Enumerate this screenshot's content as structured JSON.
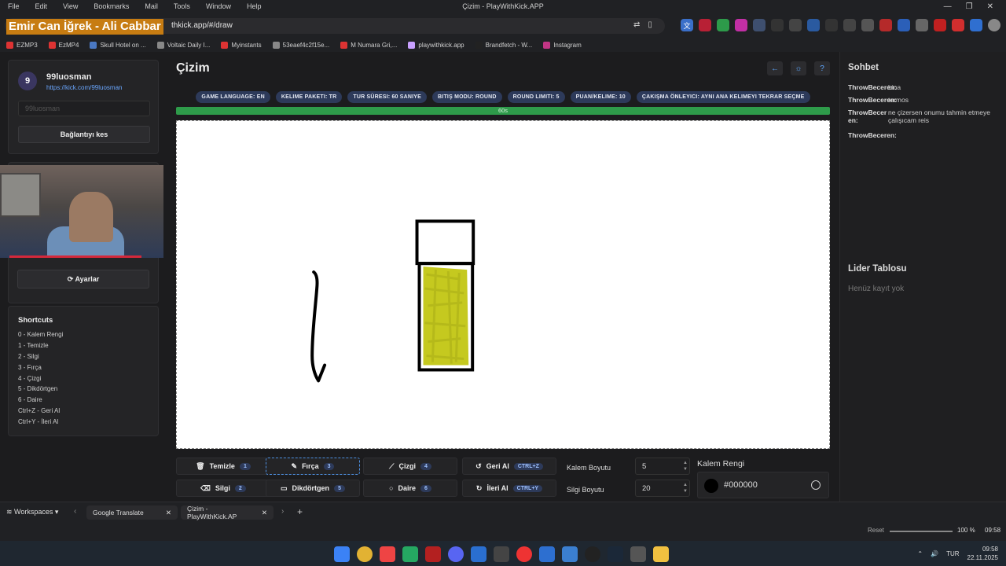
{
  "menubar": {
    "items": [
      "File",
      "Edit",
      "View",
      "Bookmarks",
      "Mail",
      "Tools",
      "Window",
      "Help"
    ],
    "window_title": "Çizim - PlayWithKick.APP"
  },
  "address": {
    "url": "thkick.app/#/draw"
  },
  "overlay": {
    "streamer_names": "Emir Can İğrek - Ali Cabbar"
  },
  "bookmarks": [
    {
      "label": "EZMP3",
      "color": "#d33"
    },
    {
      "label": "EzMP4",
      "color": "#d33"
    },
    {
      "label": "Skull Hotel on ...",
      "color": "#4a78c2"
    },
    {
      "label": "Voltaic Daily I...",
      "color": "#888"
    },
    {
      "label": "Myinstants",
      "color": "#d33"
    },
    {
      "label": "53eaef4c2f15e...",
      "color": "#888"
    },
    {
      "label": "M Numara Gri,...",
      "color": "#d33"
    },
    {
      "label": "playwithkick.app",
      "color": "#c8a0ff"
    },
    {
      "label": "Brandfetch - W...",
      "color": "#222"
    },
    {
      "label": "Instagram",
      "color": "#c13584"
    }
  ],
  "profile": {
    "avatar_initial": "9",
    "username": "99luosman",
    "link": "https://kick.com/99luosman",
    "input_placeholder": "99luosman",
    "disconnect_label": "Bağlantıyı kes"
  },
  "settings_label": "Ayarlar",
  "shortcuts": {
    "title": "Shortcuts",
    "items": [
      "0 - Kalem Rengi",
      "1 - Temizle",
      "2 - Silgi",
      "3 - Fırça",
      "4 - Çizgi",
      "5 - Dikdörtgen",
      "6 - Daire",
      "Ctrl+Z - Geri Al",
      "Ctrl+Y - İleri Al"
    ]
  },
  "page": {
    "title": "Çizim"
  },
  "badges": [
    "GAME LANGUAGE: EN",
    "KELIME PAKETI: TR",
    "TUR SÜRESI: 60 SANIYE",
    "BITIŞ MODU: ROUND",
    "ROUND LIMITI: 5",
    "PUAN/KELIME: 10",
    "ÇAKIŞMA ÖNLEYICI: AYNI ANA KELIMEYI TEKRAR SEÇME"
  ],
  "timer": {
    "label": "60s",
    "fraction": 1.0
  },
  "tools": {
    "clear": {
      "label": "Temizle",
      "key": "1"
    },
    "brush": {
      "label": "Fırça",
      "key": "3"
    },
    "line": {
      "label": "Çizgi",
      "key": "4"
    },
    "undo": {
      "label": "Geri Al",
      "key": "CTRL+Z"
    },
    "eraser": {
      "label": "Silgi",
      "key": "2"
    },
    "rect": {
      "label": "Dikdörtgen",
      "key": "5"
    },
    "circle": {
      "label": "Daire",
      "key": "6"
    },
    "redo": {
      "label": "İleri Al",
      "key": "CTRL+Y"
    },
    "pen_size_label": "Kalem Boyutu",
    "pen_size": "5",
    "eraser_size_label": "Silgi Boyutu",
    "eraser_size": "20",
    "color_label": "Kalem Rengi",
    "color_value": "#000000"
  },
  "chat": {
    "title": "Sohbet",
    "messages": [
      {
        "user": "ThrowBeceren:",
        "text": "bina"
      },
      {
        "user": "ThrowBeceren:",
        "text": "termos"
      },
      {
        "user": "ThrowBeceren:",
        "text": "ne çizersen onumu tahmin etmeye çalışıcam reis"
      },
      {
        "user": "ThrowBeceren:",
        "text": "."
      }
    ]
  },
  "leaderboard": {
    "title": "Lider Tablosu",
    "empty": "Henüz kayıt yok"
  },
  "workspaces": {
    "label": "Workspaces",
    "tabs": [
      "Google Translate",
      "Çizim - PlayWithKick.AP"
    ]
  },
  "status": {
    "reset": "Reset",
    "zoom": "100 %",
    "time": "09:58"
  },
  "taskbar": {
    "lang": "TUR",
    "time": "09:58",
    "date": "22.11.2025"
  },
  "colors": {
    "accent": "#5ea8ff",
    "timer": "#2e9b4a",
    "badge": "#2d3a5a",
    "yellow_fill": "#c5c91f"
  }
}
